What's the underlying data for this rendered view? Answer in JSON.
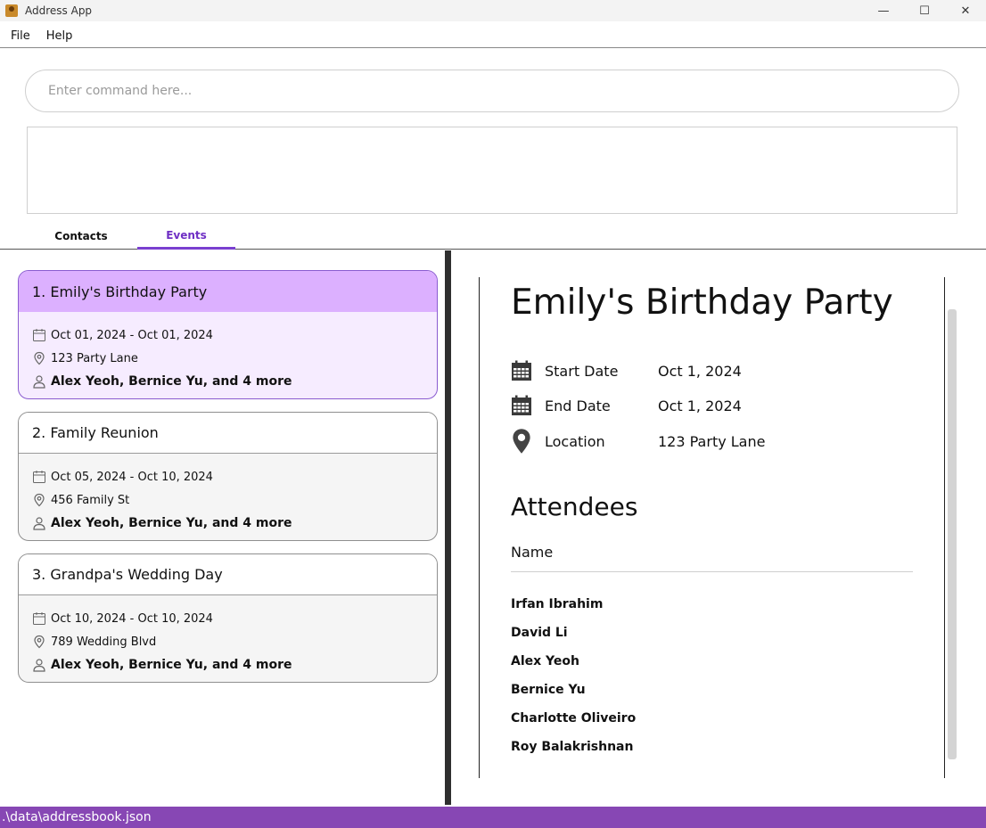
{
  "window": {
    "title": "Address App",
    "minimize": "—",
    "maximize": "☐",
    "close": "✕"
  },
  "menu": {
    "file": "File",
    "help": "Help"
  },
  "command": {
    "placeholder": "Enter command here...",
    "value": ""
  },
  "tabs": [
    {
      "label": "Contacts"
    },
    {
      "label": "Events",
      "selected": true
    }
  ],
  "events": [
    {
      "title": "1. Emily's Birthday Party",
      "dates": "Oct 01, 2024  - Oct 01, 2024",
      "location": "123 Party Lane",
      "attendees": "Alex Yeoh, Bernice Yu, and 4 more"
    },
    {
      "title": "2. Family Reunion",
      "dates": "Oct 05, 2024  - Oct 10, 2024",
      "location": "456 Family St",
      "attendees": "Alex Yeoh, Bernice Yu, and 4 more"
    },
    {
      "title": "3. Grandpa's Wedding Day",
      "dates": "Oct 10, 2024  - Oct 10, 2024",
      "location": "789 Wedding Blvd",
      "attendees": "Alex Yeoh, Bernice Yu, and 4 more"
    }
  ],
  "detail": {
    "title": "Emily's Birthday Party",
    "start_label": "Start Date",
    "start_value": "Oct 1, 2024",
    "end_label": "End Date",
    "end_value": "Oct 1, 2024",
    "location_label": "Location",
    "location_value": "123 Party Lane",
    "attendees_title": "Attendees",
    "name_header": "Name",
    "attendees": [
      "Irfan Ibrahim",
      "David Li",
      "Alex Yeoh",
      "Bernice Yu",
      "Charlotte Oliveiro",
      "Roy Balakrishnan"
    ]
  },
  "status": {
    "path": ".\\data\\addressbook.json"
  },
  "colors": {
    "accent": "#7a40d0",
    "selected_header": "#dcb0ff",
    "selected_body": "#f6ecff",
    "status_bar": "#8747b4"
  }
}
